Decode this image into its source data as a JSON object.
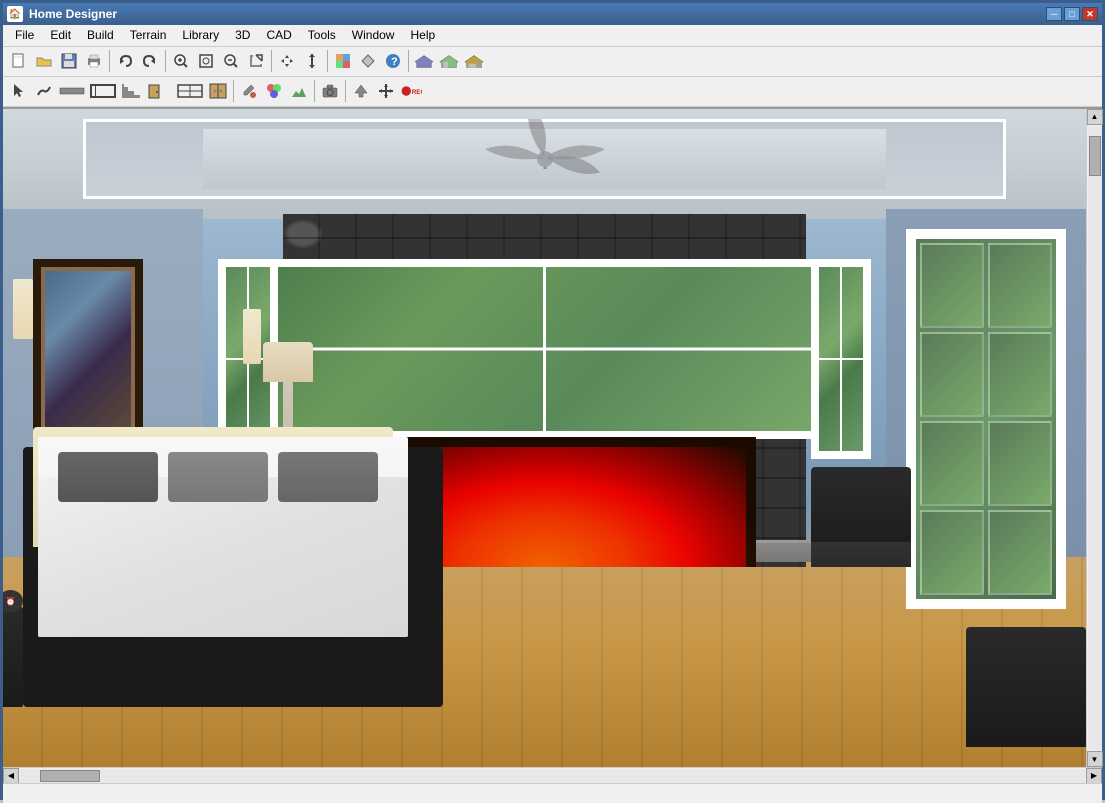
{
  "window": {
    "title": "Home Designer",
    "controls": {
      "minimize": "─",
      "maximize": "□",
      "close": "✕"
    }
  },
  "menu": {
    "items": [
      {
        "id": "file",
        "label": "File"
      },
      {
        "id": "edit",
        "label": "Edit"
      },
      {
        "id": "build",
        "label": "Build"
      },
      {
        "id": "terrain",
        "label": "Terrain"
      },
      {
        "id": "library",
        "label": "Library"
      },
      {
        "id": "3d",
        "label": "3D"
      },
      {
        "id": "cad",
        "label": "CAD"
      },
      {
        "id": "tools",
        "label": "Tools"
      },
      {
        "id": "window",
        "label": "Window"
      },
      {
        "id": "help",
        "label": "Help"
      }
    ]
  },
  "toolbar1": {
    "buttons": [
      {
        "id": "new",
        "icon": "📄",
        "label": "New"
      },
      {
        "id": "open",
        "icon": "📂",
        "label": "Open"
      },
      {
        "id": "save",
        "icon": "💾",
        "label": "Save"
      },
      {
        "id": "print",
        "icon": "🖨",
        "label": "Print"
      },
      {
        "id": "undo",
        "icon": "↩",
        "label": "Undo"
      },
      {
        "id": "redo",
        "icon": "↪",
        "label": "Redo"
      },
      {
        "id": "zoom-in",
        "icon": "🔍",
        "label": "Zoom In"
      },
      {
        "id": "zoom-window",
        "icon": "⊞",
        "label": "Zoom Window"
      },
      {
        "id": "zoom-out",
        "icon": "🔍",
        "label": "Zoom Out"
      },
      {
        "id": "fit",
        "icon": "⊡",
        "label": "Fit"
      },
      {
        "id": "arrows",
        "icon": "↔",
        "label": "Pan"
      },
      {
        "id": "dimensions",
        "icon": "↕",
        "label": "Dimensions"
      },
      {
        "id": "help",
        "icon": "?",
        "label": "Help"
      },
      {
        "id": "house1",
        "icon": "🏠",
        "label": "House View 1"
      },
      {
        "id": "house2",
        "icon": "🏡",
        "label": "House View 2"
      },
      {
        "id": "house3",
        "icon": "🏘",
        "label": "House View 3"
      }
    ]
  },
  "toolbar2": {
    "buttons": [
      {
        "id": "select",
        "icon": "↖",
        "label": "Select"
      },
      {
        "id": "polyline",
        "icon": "∿",
        "label": "Polyline"
      },
      {
        "id": "wall",
        "icon": "⊟",
        "label": "Wall"
      },
      {
        "id": "room",
        "icon": "⊞",
        "label": "Room"
      },
      {
        "id": "stair",
        "icon": "▤",
        "label": "Stair"
      },
      {
        "id": "door",
        "icon": "◫",
        "label": "Door"
      },
      {
        "id": "window-tool",
        "icon": "⊡",
        "label": "Window"
      },
      {
        "id": "cabinet",
        "icon": "▦",
        "label": "Cabinet"
      },
      {
        "id": "paint",
        "icon": "🖊",
        "label": "Paint"
      },
      {
        "id": "material",
        "icon": "🎨",
        "label": "Material"
      },
      {
        "id": "terrain-tool",
        "icon": "⛰",
        "label": "Terrain"
      },
      {
        "id": "camera",
        "icon": "📷",
        "label": "Camera"
      },
      {
        "id": "arrow-up",
        "icon": "⬆",
        "label": "Up"
      },
      {
        "id": "move",
        "icon": "✛",
        "label": "Move"
      },
      {
        "id": "record",
        "icon": "⏺",
        "label": "Record"
      }
    ]
  },
  "viewport": {
    "scene": "3D bedroom interior view",
    "description": "Modern bedroom with stone fireplace, French doors, and hardwood floors"
  },
  "statusbar": {
    "text": ""
  }
}
